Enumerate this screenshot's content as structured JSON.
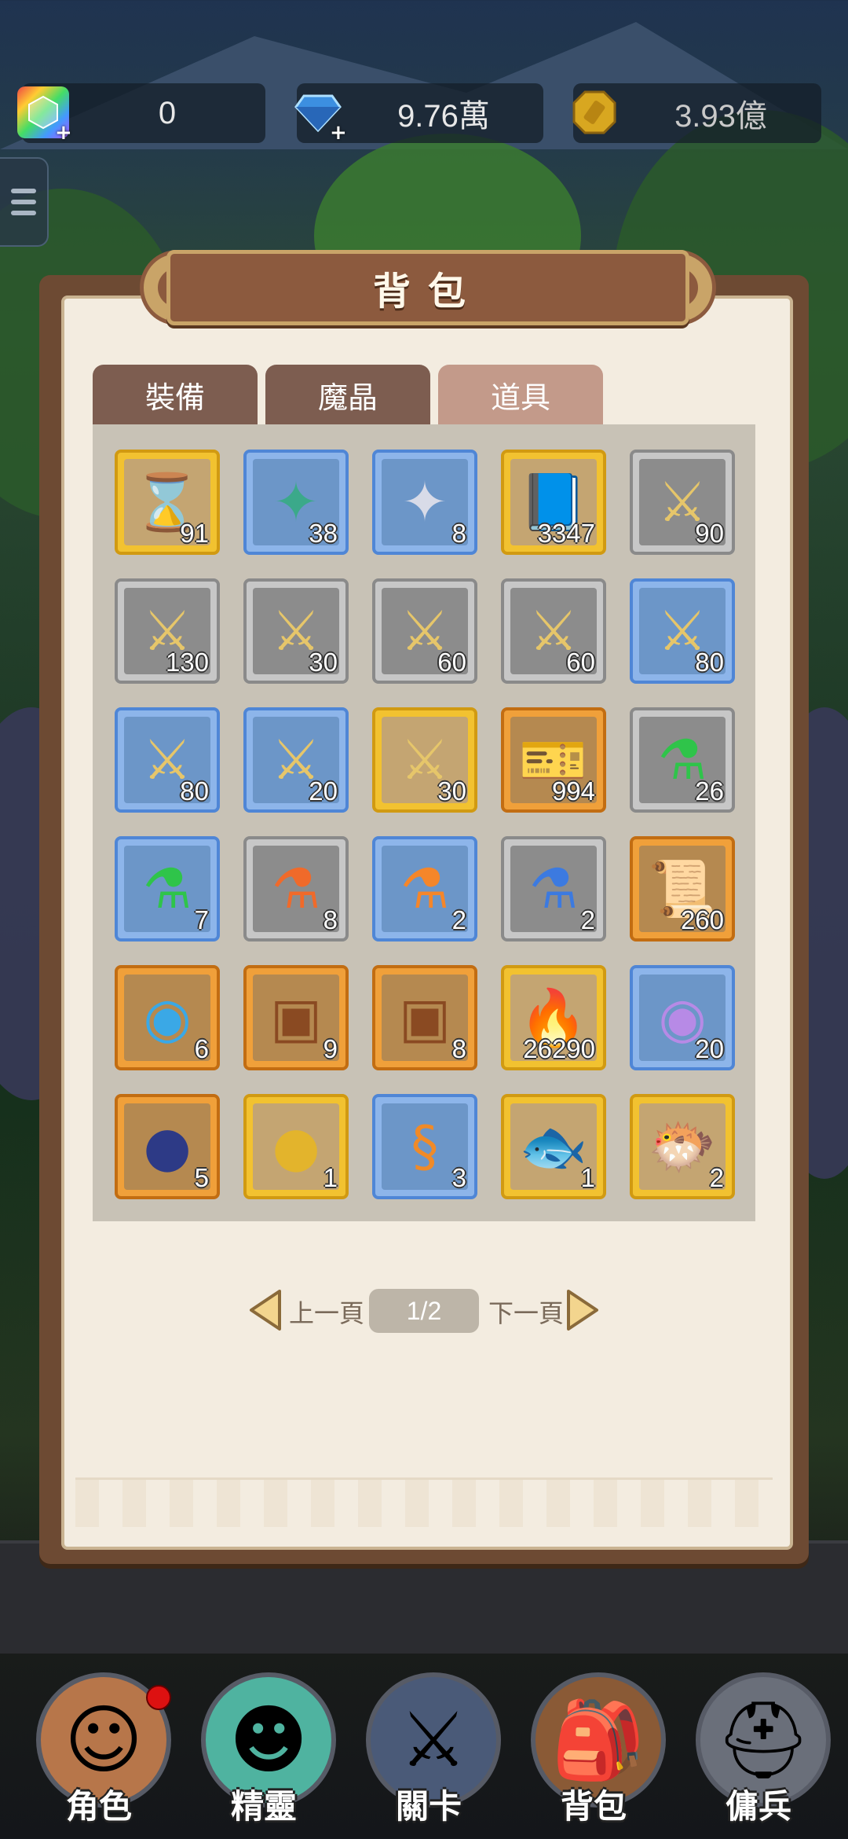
{
  "resources": {
    "rainbow_gem": {
      "value": "0",
      "icon": "rainbow-gem-icon"
    },
    "diamond": {
      "value": "9.76萬",
      "icon": "blue-diamond-icon"
    },
    "gold": {
      "value": "3.93億",
      "icon": "gold-coin-icon"
    }
  },
  "panel": {
    "title": "背包",
    "tabs": [
      {
        "label": "裝備",
        "active": false
      },
      {
        "label": "魔晶",
        "active": false
      },
      {
        "label": "道具",
        "active": true
      }
    ]
  },
  "items": [
    {
      "name": "hourglass",
      "count": "91",
      "rarity": "gold",
      "glyph": "⌛",
      "color": "#3da64a"
    },
    {
      "name": "green-crystal-wing",
      "count": "38",
      "rarity": "blue",
      "glyph": "✦",
      "color": "#3ba98a"
    },
    {
      "name": "silver-crystal-wing",
      "count": "8",
      "rarity": "blue",
      "glyph": "✦",
      "color": "#d8dbe8"
    },
    {
      "name": "blue-book",
      "count": "3347",
      "rarity": "gold",
      "glyph": "📘",
      "color": "#4a78b8"
    },
    {
      "name": "hero-fragment",
      "count": "90",
      "rarity": "gray",
      "glyph": "⚔",
      "color": "#e6c66a"
    },
    {
      "name": "hero-fragment",
      "count": "130",
      "rarity": "gray",
      "glyph": "⚔",
      "color": "#e6c66a"
    },
    {
      "name": "hero-fragment",
      "count": "30",
      "rarity": "gray",
      "glyph": "⚔",
      "color": "#e6c66a"
    },
    {
      "name": "hero-fragment",
      "count": "60",
      "rarity": "gray",
      "glyph": "⚔",
      "color": "#e6c66a"
    },
    {
      "name": "hero-fragment",
      "count": "60",
      "rarity": "gray",
      "glyph": "⚔",
      "color": "#e6c66a"
    },
    {
      "name": "hero-fragment",
      "count": "80",
      "rarity": "blue",
      "glyph": "⚔",
      "color": "#e6c66a"
    },
    {
      "name": "hero-fragment",
      "count": "80",
      "rarity": "blue",
      "glyph": "⚔",
      "color": "#e6c66a"
    },
    {
      "name": "hero-fragment",
      "count": "20",
      "rarity": "blue",
      "glyph": "⚔",
      "color": "#e6c66a"
    },
    {
      "name": "hero-fragment",
      "count": "30",
      "rarity": "gold",
      "glyph": "⚔",
      "color": "#e6c66a"
    },
    {
      "name": "ticket",
      "count": "994",
      "rarity": "orange",
      "glyph": "🎫",
      "color": "#f1c74c"
    },
    {
      "name": "green-potion",
      "count": "26",
      "rarity": "gray",
      "glyph": "⚗",
      "color": "#2fc44a"
    },
    {
      "name": "green-potion",
      "count": "7",
      "rarity": "blue",
      "glyph": "⚗",
      "color": "#2fc44a"
    },
    {
      "name": "red-potion",
      "count": "8",
      "rarity": "gray",
      "glyph": "⚗",
      "color": "#f06a2a"
    },
    {
      "name": "orange-potion",
      "count": "2",
      "rarity": "blue",
      "glyph": "⚗",
      "color": "#f5862a"
    },
    {
      "name": "blue-potion",
      "count": "2",
      "rarity": "gray",
      "glyph": "⚗",
      "color": "#3c7ae0"
    },
    {
      "name": "scroll",
      "count": "260",
      "rarity": "orange",
      "glyph": "📜",
      "color": "#e8c79a"
    },
    {
      "name": "crystal-orb",
      "count": "6",
      "rarity": "orange",
      "glyph": "◉",
      "color": "#3aa8e6"
    },
    {
      "name": "treasure-chest",
      "count": "9",
      "rarity": "orange",
      "glyph": "▣",
      "color": "#8a4a22"
    },
    {
      "name": "treasure-chest",
      "count": "8",
      "rarity": "orange",
      "glyph": "▣",
      "color": "#8a4a22"
    },
    {
      "name": "fire-essence",
      "count": "26290",
      "rarity": "gold",
      "glyph": "🔥",
      "color": "#f5a51e"
    },
    {
      "name": "winged-orb",
      "count": "20",
      "rarity": "blue",
      "glyph": "◉",
      "color": "#b78ae6"
    },
    {
      "name": "dark-rune-stone",
      "count": "5",
      "rarity": "orange",
      "glyph": "●",
      "color": "#2d3a86"
    },
    {
      "name": "gold-rune-stone",
      "count": "1",
      "rarity": "gold",
      "glyph": "●",
      "color": "#e3b42c"
    },
    {
      "name": "orange-worm",
      "count": "3",
      "rarity": "blue",
      "glyph": "§",
      "color": "#f08a28"
    },
    {
      "name": "tuna-fish",
      "count": "1",
      "rarity": "gold",
      "glyph": "🐟",
      "color": "#3a6fb8"
    },
    {
      "name": "pufferfish",
      "count": "2",
      "rarity": "gold",
      "glyph": "🐡",
      "color": "#3a84d8"
    }
  ],
  "pagination": {
    "prev_label": "上一頁",
    "page": "1/2",
    "next_label": "下一頁"
  },
  "nav": [
    {
      "label": "角色",
      "glyph": "☺",
      "badge": true
    },
    {
      "label": "精靈",
      "glyph": "☻",
      "badge": false
    },
    {
      "label": "關卡",
      "glyph": "⚔",
      "badge": false
    },
    {
      "label": "背包",
      "glyph": "🎒",
      "badge": false
    },
    {
      "label": "傭兵",
      "glyph": "⛑",
      "badge": false
    }
  ]
}
